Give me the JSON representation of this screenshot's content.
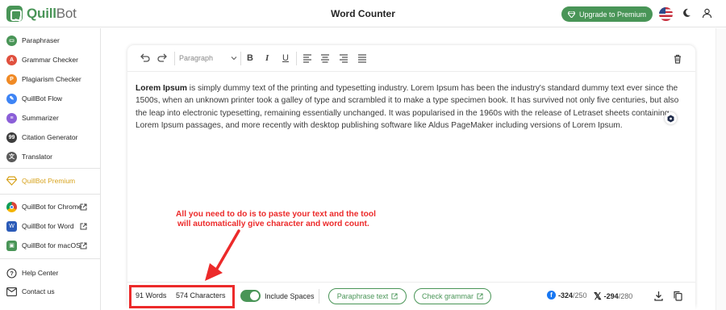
{
  "header": {
    "logo_prefix": "Quill",
    "logo_suffix": "Bot",
    "title": "Word Counter",
    "upgrade_label": "Upgrade to Premium"
  },
  "sidebar": {
    "items": [
      {
        "label": "Paraphraser",
        "icon": "paraphraser-icon",
        "color": "#499557"
      },
      {
        "label": "Grammar Checker",
        "icon": "grammar-checker-icon",
        "color": "#e0503e"
      },
      {
        "label": "Plagiarism Checker",
        "icon": "plagiarism-checker-icon",
        "color": "#f08a25"
      },
      {
        "label": "QuillBot Flow",
        "icon": "flow-icon",
        "color": "#3d84f5"
      },
      {
        "label": "Summarizer",
        "icon": "summarizer-icon",
        "color": "#8b5fd8"
      },
      {
        "label": "Citation Generator",
        "icon": "citation-generator-icon",
        "color": "#3d3d3d"
      },
      {
        "label": "Translator",
        "icon": "translator-icon",
        "color": "#5a5a5a"
      }
    ],
    "premium_label": "QuillBot Premium",
    "extensions": [
      {
        "label": "QuillBot for Chrome",
        "icon": "chrome-icon"
      },
      {
        "label": "QuillBot for Word",
        "icon": "word-icon"
      },
      {
        "label": "QuillBot for macOS",
        "icon": "macos-icon"
      }
    ],
    "help_label": "Help Center",
    "contact_label": "Contact us"
  },
  "toolbar": {
    "paragraph_select": "Paragraph"
  },
  "editor": {
    "bold_lead": "Lorem Ipsum",
    "body": " is simply dummy text of the printing and typesetting industry. Lorem Ipsum has been the industry's standard dummy text ever since the 1500s, when an unknown printer took a galley of type and scrambled it to make a type specimen book. It has survived not only five centuries, but also the leap into electronic typesetting, remaining essentially unchanged. It was popularised in the 1960s with the release of Letraset sheets containing Lorem Ipsum passages, and more recently with desktop publishing software like Aldus PageMaker including versions of Lorem Ipsum."
  },
  "annotation": {
    "line1": "All you need to do is to paste your text and the tool",
    "line2": "will automatically give character and word count."
  },
  "bottom": {
    "words": "91 Words",
    "characters": "574 Characters",
    "include_spaces_label": "Include Spaces",
    "include_spaces_on": true,
    "paraphrase_label": "Paraphrase text",
    "grammar_label": "Check grammar",
    "facebook_count": "-324",
    "facebook_limit": "/250",
    "x_count": "-294",
    "x_limit": "/280"
  },
  "colors": {
    "brand": "#499557",
    "annotation": "#ec2a2a",
    "premium": "#d7a21b"
  }
}
